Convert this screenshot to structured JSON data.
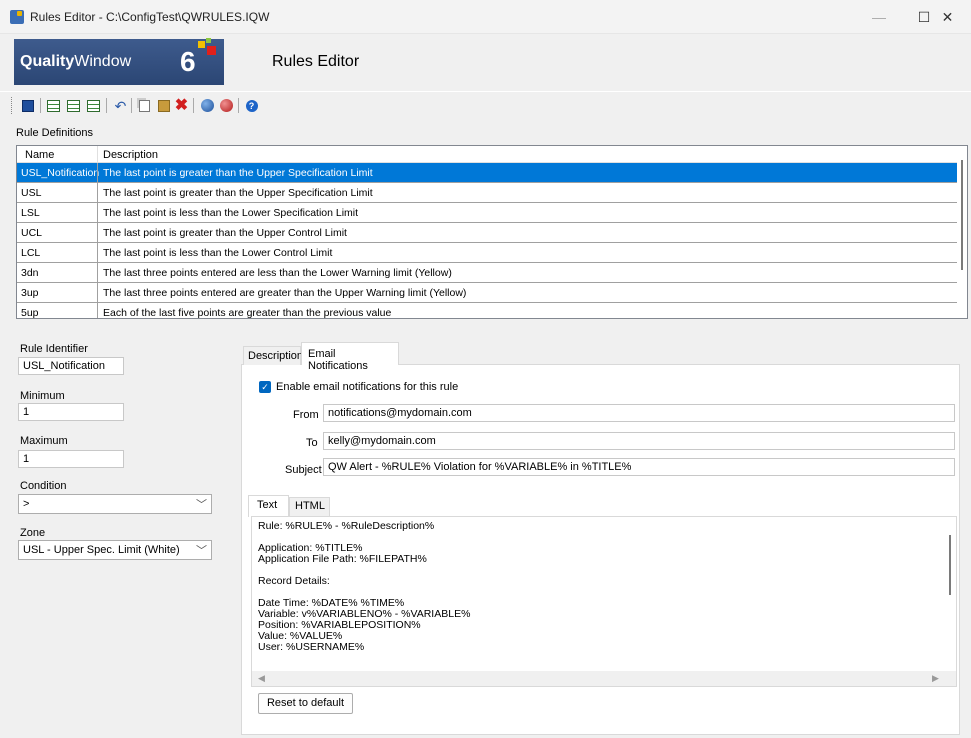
{
  "window": {
    "title": "Rules Editor - C:\\ConfigTest\\QWRULES.IQW",
    "minimize": "—",
    "maximize": "☐",
    "close": "✕"
  },
  "banner": {
    "logo_bold": "Quality",
    "logo_rest": "Window",
    "logo_number": "6",
    "heading": "Rules Editor"
  },
  "toolbar": {
    "icons": [
      "save-icon",
      "add-row-icon",
      "insert-row-icon",
      "append-row-icon",
      "undo-icon",
      "copy-icon",
      "paste-icon",
      "delete-icon",
      "import-icon",
      "export-icon",
      "help-icon"
    ]
  },
  "rule_definitions": {
    "label": "Rule Definitions",
    "columns": [
      "Name",
      "Description"
    ],
    "rows": [
      {
        "name": "USL_Notification",
        "description": "The last point is greater than the Upper Specification Limit",
        "selected": true
      },
      {
        "name": "USL",
        "description": "The last point is greater than the Upper Specification Limit"
      },
      {
        "name": "LSL",
        "description": "The last point is less than the Lower Specification Limit"
      },
      {
        "name": "UCL",
        "description": "The last point is greater than the Upper Control Limit"
      },
      {
        "name": "LCL",
        "description": "The last point is less than the Lower Control Limit"
      },
      {
        "name": "3dn",
        "description": "The last three points entered are less than the Lower Warning limit (Yellow)"
      },
      {
        "name": "3up",
        "description": "The last three points entered are greater than the Upper Warning limit (Yellow)"
      },
      {
        "name": "5up",
        "description": "Each of the last five points are greater than the previous value"
      }
    ]
  },
  "left_panel": {
    "rule_identifier_label": "Rule Identifier",
    "rule_identifier": "USL_Notification",
    "minimum_label": "Minimum",
    "minimum": "1",
    "maximum_label": "Maximum",
    "maximum": "1",
    "condition_label": "Condition",
    "condition": ">",
    "zone_label": "Zone",
    "zone": "USL - Upper Spec. Limit (White)"
  },
  "tabs": {
    "description": "Description",
    "email": "Email Notifications"
  },
  "email": {
    "enable_label": "Enable email notifications for this rule",
    "enabled": true,
    "from_label": "From",
    "from": "notifications@mydomain.com",
    "to_label": "To",
    "to": "kelly@mydomain.com",
    "subject_label": "Subject",
    "subject": "QW Alert - %RULE% Violation for %VARIABLE% in  %TITLE%",
    "body_tabs": {
      "text": "Text",
      "html": "HTML"
    },
    "body": "Rule: %RULE% - %RuleDescription%\n\nApplication: %TITLE%\nApplication File Path: %FILEPATH%\n\nRecord Details:\n\nDate Time: %DATE% %TIME%\nVariable: v%VARIABLENO% - %VARIABLE%\nPosition: %VARIABLEPOSITION%\nValue: %VALUE%\nUser: %USERNAME%",
    "reset_label": "Reset to default"
  },
  "colors": {
    "selection": "#0078d7",
    "banner_blue": "#3e5b8d",
    "checkbox": "#0067c0"
  }
}
